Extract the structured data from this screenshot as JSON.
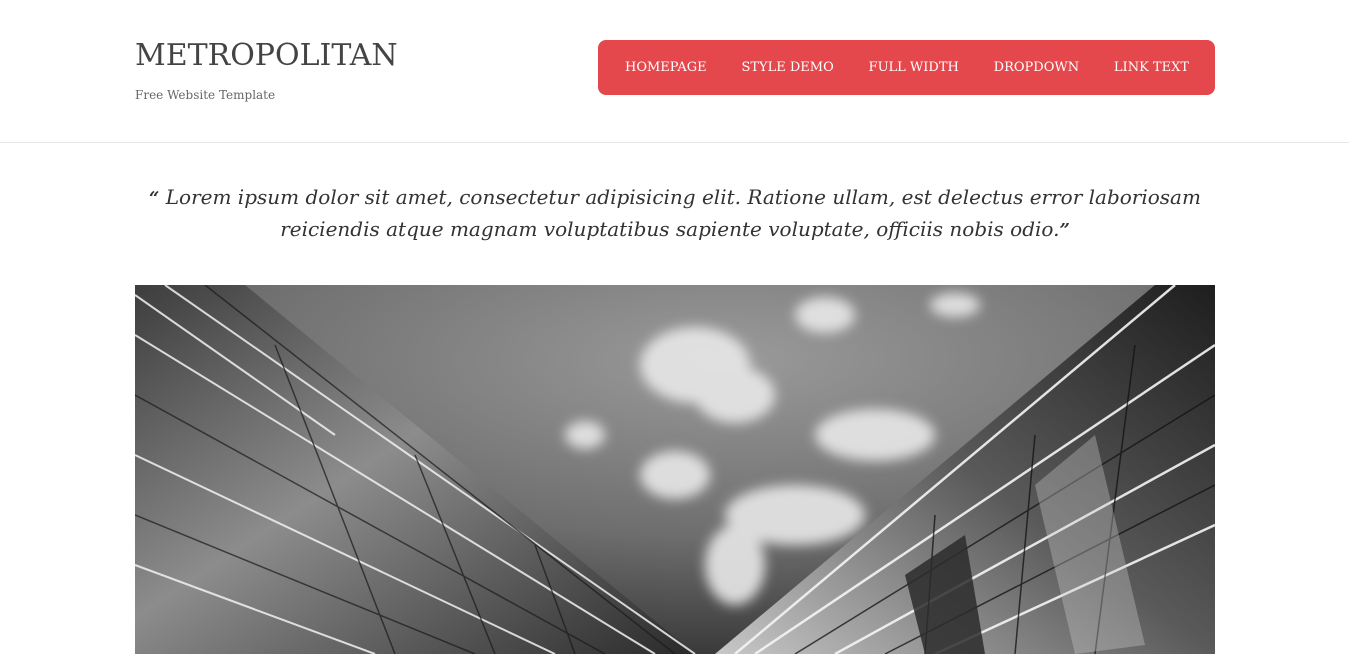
{
  "site": {
    "title": "METROPOLITAN",
    "subtitle": "Free Website Template"
  },
  "nav": {
    "color": "#e4474c",
    "items": [
      {
        "label": "HOMEPAGE"
      },
      {
        "label": "STYLE DEMO"
      },
      {
        "label": "FULL WIDTH"
      },
      {
        "label": "DROPDOWN"
      },
      {
        "label": "LINK TEXT"
      }
    ]
  },
  "quote": {
    "open": "“",
    "text": "Lorem ipsum dolor sit amet, consectetur adipisicing elit. Ratione ullam, est delectus error laboriosam reiciendis atque magnam voluptatibus sapiente voluptate, officiis nobis odio.",
    "close": "”"
  },
  "hero": {
    "icon": "building-glass-sky-image"
  }
}
